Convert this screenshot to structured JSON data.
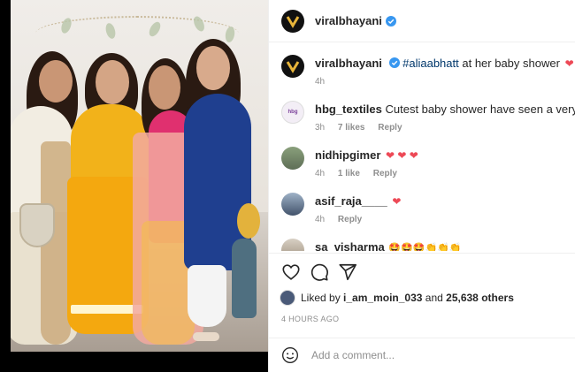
{
  "header": {
    "username": "viralbhayani",
    "avatar_icon": "v-logo-icon",
    "verified_icon": "verified-badge-icon"
  },
  "caption": {
    "username": "viralbhayani",
    "mention": "#aliaabhatt",
    "text": " at her baby shower",
    "emoji": "❤",
    "time": "4h"
  },
  "comments": [
    {
      "username": "hbg_textiles",
      "text": "Cutest baby shower have seen a very long time",
      "time": "3h",
      "likes": "7 likes",
      "reply": "Reply"
    },
    {
      "username": "nidhipgimer",
      "text": "",
      "emoji": "❤ ❤ ❤",
      "time": "4h",
      "likes": "1 like",
      "reply": "Reply"
    },
    {
      "username": "asif_raja____",
      "text": "",
      "emoji": "❤",
      "time": "4h",
      "reply": "Reply"
    },
    {
      "username": "sa_visharma",
      "text": "",
      "emoji": "🤩🤩🤩👏👏👏"
    }
  ],
  "actions": {
    "like_icon": "heart-icon",
    "comment_icon": "comment-icon",
    "share_icon": "share-icon"
  },
  "likes": {
    "liked_by": "Liked by",
    "user": "i_am_moin_033",
    "and": "and",
    "count": "25,638 others"
  },
  "timestamp": "4 HOURS AGO",
  "add_comment": {
    "placeholder": "Add a comment...",
    "emoji_icon": "smiley-icon"
  },
  "colors": {
    "verified": "#3897f0",
    "heart": "#ed4956",
    "mention": "#00376b",
    "muted": "#8e8e8e"
  }
}
